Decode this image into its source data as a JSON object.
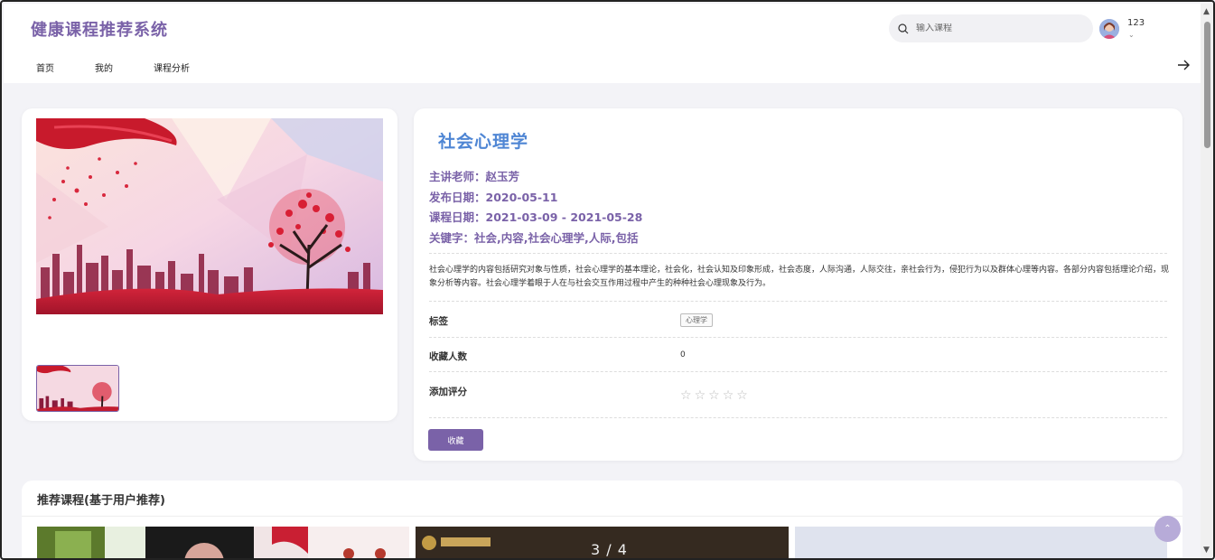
{
  "header": {
    "logo": "健康课程推荐系统",
    "search_placeholder": "输入课程",
    "username": "123",
    "nav": [
      "首页",
      "我的",
      "课程分析"
    ]
  },
  "course": {
    "title": "社会心理学",
    "teacher": "主讲老师：赵玉芳",
    "publish_date": "发布日期：2020-05-11",
    "course_date": "课程日期：2021-03-09 - 2021-05-28",
    "keywords": "关键字：社会,内容,社会心理学,人际,包括",
    "description": "社会心理学的内容包括研究对象与性质，社会心理学的基本理论，社会化，社会认知及印象形成，社会态度，人际沟通，人际交往，亲社会行为，侵犯行为以及群体心理等内容。各部分内容包括理论介绍，现象分析等内容。社会心理学着眼于人在与社会交互作用过程中产生的种种社会心理现象及行为。",
    "tag_label": "标签",
    "tag": "心理学",
    "fav_label": "收藏人数",
    "fav_count": "0",
    "rating_label": "添加评分",
    "rating_value": 0,
    "rating_max": 5,
    "fav_button": "收藏"
  },
  "recommend": {
    "title": "推荐课程(基于用户推荐)",
    "counter": "3 / 4"
  },
  "colors": {
    "brand": "#7a62a8",
    "title_blue": "#4f86d4"
  }
}
